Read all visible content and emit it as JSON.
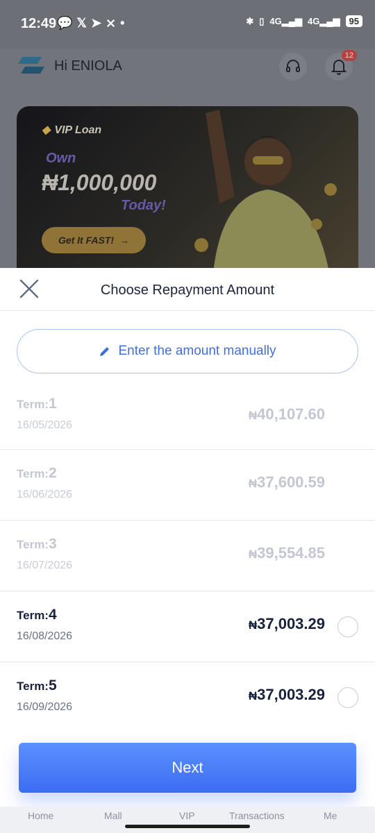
{
  "status_bar": {
    "time": "12:49",
    "left_icons": [
      "chat-bubble-icon",
      "x-logo-icon",
      "telegram-icon",
      "capcut-icon",
      "dot-icon"
    ],
    "network": "4G",
    "battery": "95"
  },
  "background_app": {
    "greeting": "Hi ENIOLA",
    "notification_count": "12",
    "banner": {
      "title": "VIP Loan",
      "own": "Own",
      "amount": "₦1,000,000",
      "today": "Today!",
      "cta": "Get It FAST!"
    },
    "bottom_nav": [
      "Home",
      "Mall",
      "VIP",
      "Transactions",
      "Me"
    ]
  },
  "sheet": {
    "title": "Choose Repayment Amount",
    "manual_entry_label": "Enter the amount manually",
    "term_prefix": "Term:",
    "terms": [
      {
        "number": "1",
        "date": "16/05/2026",
        "currency": "₦",
        "amount": "40,107.60",
        "selectable": false
      },
      {
        "number": "2",
        "date": "16/06/2026",
        "currency": "₦",
        "amount": "37,600.59",
        "selectable": false
      },
      {
        "number": "3",
        "date": "16/07/2026",
        "currency": "₦",
        "amount": "39,554.85",
        "selectable": false
      },
      {
        "number": "4",
        "date": "16/08/2026",
        "currency": "₦",
        "amount": "37,003.29",
        "selectable": true
      },
      {
        "number": "5",
        "date": "16/09/2026",
        "currency": "₦",
        "amount": "37,003.29",
        "selectable": true
      }
    ],
    "next_label": "Next"
  },
  "colors": {
    "primary": "#3e6fe3",
    "button_gradient_top": "#5b90ff",
    "button_gradient_bottom": "#3d6cf2",
    "text_dark": "#18213d",
    "text_disabled": "#c3c7d1"
  }
}
